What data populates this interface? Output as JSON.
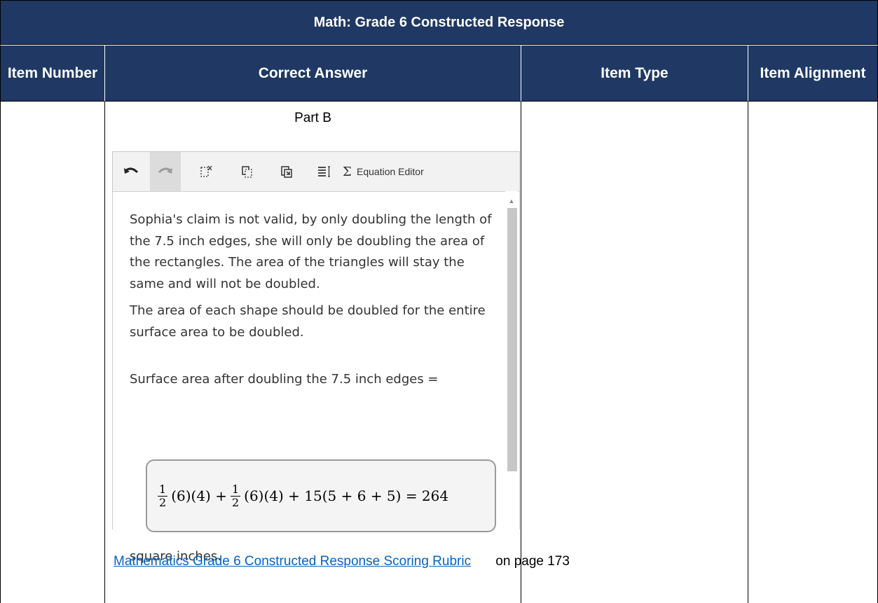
{
  "table": {
    "title": "Math: Grade 6 Constructed Response",
    "headers": {
      "item_number": "Item Number",
      "correct_answer": "Correct Answer",
      "item_type": "Item Type",
      "item_alignment": "Item Alignment"
    }
  },
  "answer": {
    "part_label": "Part B",
    "editor": {
      "toolbar": {
        "undo_icon": "undo-icon",
        "redo_icon": "redo-icon",
        "equation_editor_label": "Equation Editor"
      },
      "paragraph_1": "Sophia's claim is not valid, by only doubling the length of the 7.5 inch edges, she will only be doubling the area of the rectangles.  The area of the triangles will stay the same and will not be doubled.",
      "paragraph_2": "The area of each shape should be doubled for the entire surface area to be doubled.",
      "paragraph_3": "Surface area after doubling the 7.5 inch edges =",
      "equation": {
        "frac1_num": "1",
        "frac1_den": "2",
        "term1": "(6)(4) +",
        "frac2_num": "1",
        "frac2_den": "2",
        "term2": "(6)(4) + 15(5 + 6 + 5) = 264"
      },
      "paragraph_4": "square inches."
    },
    "rubric_link": "Mathematics Grade 6 Constructed Response Scoring Rubric",
    "rubric_suffix": " on page 173"
  }
}
